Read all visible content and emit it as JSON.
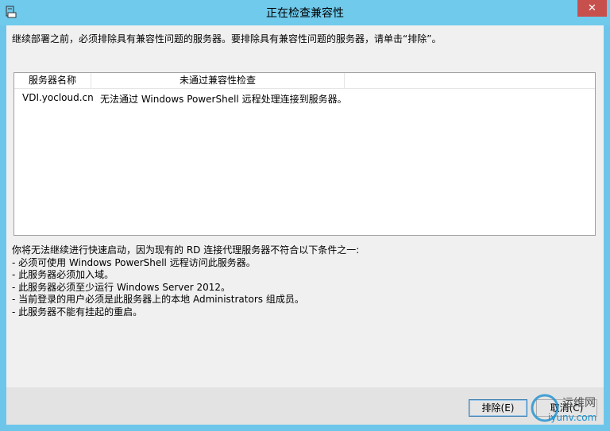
{
  "window": {
    "title": "正在检查兼容性",
    "close_glyph": "✕",
    "icon": "app-icon"
  },
  "instruction": "继续部署之前，必须排除具有兼容性问题的服务器。要排除具有兼容性问题的服务器，请单击“排除”。",
  "table": {
    "columns": [
      "服务器名称",
      "未通过兼容性检查",
      ""
    ],
    "rows": [
      {
        "server": "VDI.yocloud.cn",
        "issue": "无法通过 Windows PowerShell 远程处理连接到服务器。"
      }
    ]
  },
  "conditions": {
    "intro": "你将无法继续进行快速启动，因为现有的 RD 连接代理服务器不符合以下条件之一:",
    "items": [
      "- 必须可使用 Windows PowerShell 远程访问此服务器。",
      "- 此服务器必须加入域。",
      "- 此服务器必须至少运行 Windows Server 2012。",
      "- 当前登录的用户必须是此服务器上的本地 Administrators 组成员。",
      "- 此服务器不能有挂起的重启。"
    ]
  },
  "buttons": {
    "exclude": "排除(E)",
    "cancel": "取消(C)"
  },
  "watermark": {
    "text1": "运维网",
    "text2": "iyunv.com"
  },
  "colors": {
    "titlebar": "#6fcaec",
    "close": "#c7504d",
    "client": "#f0f0f0"
  }
}
